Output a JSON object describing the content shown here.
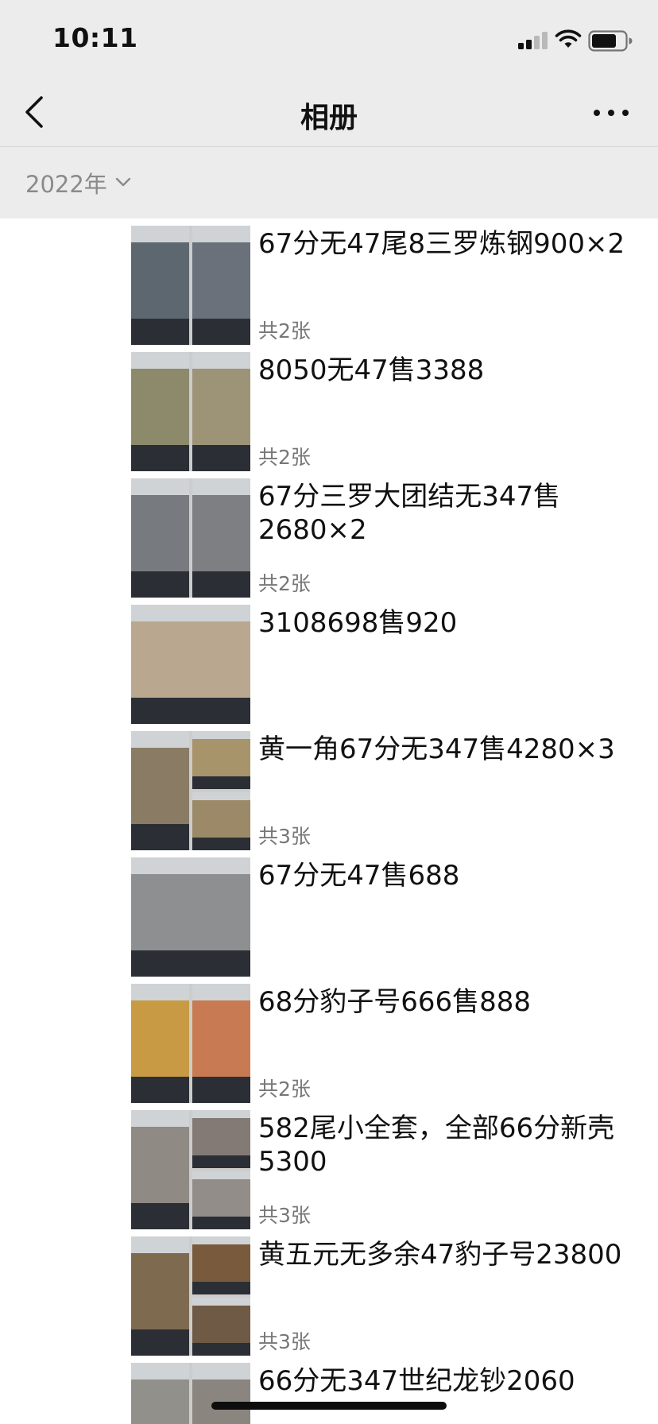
{
  "status_bar": {
    "time": "10:11"
  },
  "nav": {
    "title": "相册"
  },
  "year_filter": {
    "label": "2022年"
  },
  "albums": [
    {
      "title": "67分无47尾8三罗炼钢900×2",
      "count": "共2张",
      "thumb_layout": "two",
      "colors": [
        "#5d6770",
        "#6a717a"
      ]
    },
    {
      "title": "8050无47售3388",
      "count": "共2张",
      "thumb_layout": "two",
      "colors": [
        "#8c8a6a",
        "#9d9478"
      ]
    },
    {
      "title": "67分三罗大团结无347售2680×2",
      "count": "共2张",
      "thumb_layout": "two",
      "colors": [
        "#777a7e",
        "#7d7f83"
      ]
    },
    {
      "title": "3108698售920",
      "count": "",
      "thumb_layout": "one",
      "colors": [
        "#b9a88f"
      ]
    },
    {
      "title": "黄一角67分无347售4280×3",
      "count": "共3张",
      "thumb_layout": "three",
      "colors": [
        "#8a7b64",
        "#a8946b",
        "#9b8967"
      ]
    },
    {
      "title": "67分无47售688",
      "count": "",
      "thumb_layout": "one",
      "colors": [
        "#8d8f91"
      ]
    },
    {
      "title": "68分豹子号666售888",
      "count": "共2张",
      "thumb_layout": "two",
      "colors": [
        "#c79a43",
        "#c87a52"
      ]
    },
    {
      "title": "582尾小全套，全部66分新壳5300",
      "count": "共3张",
      "thumb_layout": "three",
      "colors": [
        "#8f8a84",
        "#837a76",
        "#938d8a"
      ]
    },
    {
      "title": "黄五元无多余47豹子号23800",
      "count": "共3张",
      "thumb_layout": "three",
      "colors": [
        "#7e6a4f",
        "#7a5a3d",
        "#6f5a45"
      ]
    },
    {
      "title": "66分无347世纪龙钞2060",
      "count": "",
      "thumb_layout": "two",
      "colors": [
        "#91908a",
        "#8b8580"
      ]
    }
  ]
}
